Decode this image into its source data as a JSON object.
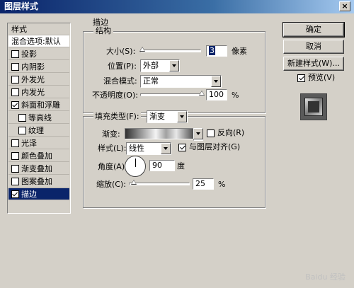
{
  "window": {
    "title": "图层样式"
  },
  "styles_list": {
    "header": "样式",
    "items": [
      {
        "label": "混合选项:默认",
        "type": "header"
      },
      {
        "label": "投影",
        "checked": false
      },
      {
        "label": "内阴影",
        "checked": false
      },
      {
        "label": "外发光",
        "checked": false
      },
      {
        "label": "内发光",
        "checked": false
      },
      {
        "label": "斜面和浮雕",
        "checked": true
      },
      {
        "label": "等高线",
        "checked": false,
        "sub": true
      },
      {
        "label": "纹理",
        "checked": false,
        "sub": true
      },
      {
        "label": "光泽",
        "checked": false
      },
      {
        "label": "颜色叠加",
        "checked": false
      },
      {
        "label": "渐变叠加",
        "checked": false
      },
      {
        "label": "图案叠加",
        "checked": false
      },
      {
        "label": "描边",
        "checked": true,
        "selected": true
      }
    ]
  },
  "stroke": {
    "section_title": "描边",
    "structure_title": "结构",
    "size_label": "大小(S):",
    "size_value": "3",
    "size_unit": "像素",
    "position_label": "位置(P):",
    "position_value": "外部",
    "blend_label": "混合模式:",
    "blend_value": "正常",
    "opacity_label": "不透明度(O):",
    "opacity_value": "100",
    "opacity_unit": "%",
    "fill_type_label": "填充类型(F):",
    "fill_type_value": "渐变",
    "gradient_label": "渐变:",
    "reverse_label": "反向(R)",
    "reverse_checked": false,
    "style_label": "样式(L):",
    "style_value": "线性",
    "align_label": "与图层对齐(G)",
    "align_checked": true,
    "angle_label": "角度(A):",
    "angle_value": "90",
    "angle_unit": "度",
    "scale_label": "缩放(C):",
    "scale_value": "25",
    "scale_unit": "%"
  },
  "buttons": {
    "ok": "确定",
    "cancel": "取消",
    "new_style": "新建样式(W)...",
    "preview_label": "预览(V)",
    "preview_checked": true
  },
  "watermark": "Baidu 经验"
}
